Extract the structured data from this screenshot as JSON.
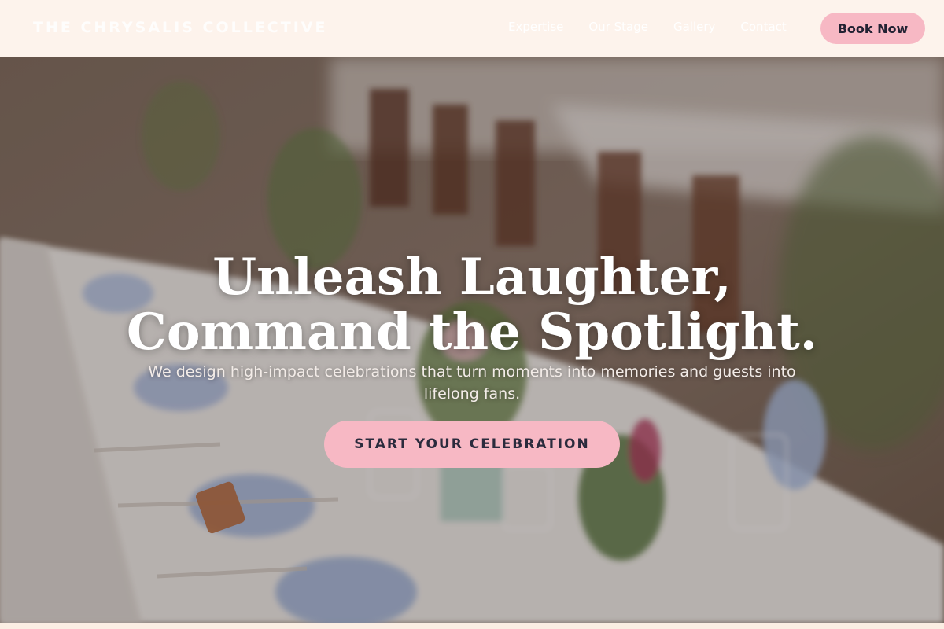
{
  "header": {
    "brand": "THE CHRYSALIS COLLECTIVE",
    "nav": [
      "Expertise",
      "Our Stage",
      "Gallery",
      "Contact"
    ],
    "book_label": "Book Now"
  },
  "hero": {
    "headline_line1": "Unleash Laughter,",
    "headline_line2": "Command the Spotlight.",
    "subtitle": "We design high-impact celebrations that turn moments into memories and guests into lifelong fans.",
    "cta_label": "START YOUR CELEBRATION"
  },
  "colors": {
    "accent_pink": "#f7b8c4",
    "header_bg": "#fdf3ec",
    "text_dark": "#2b2b3d"
  }
}
